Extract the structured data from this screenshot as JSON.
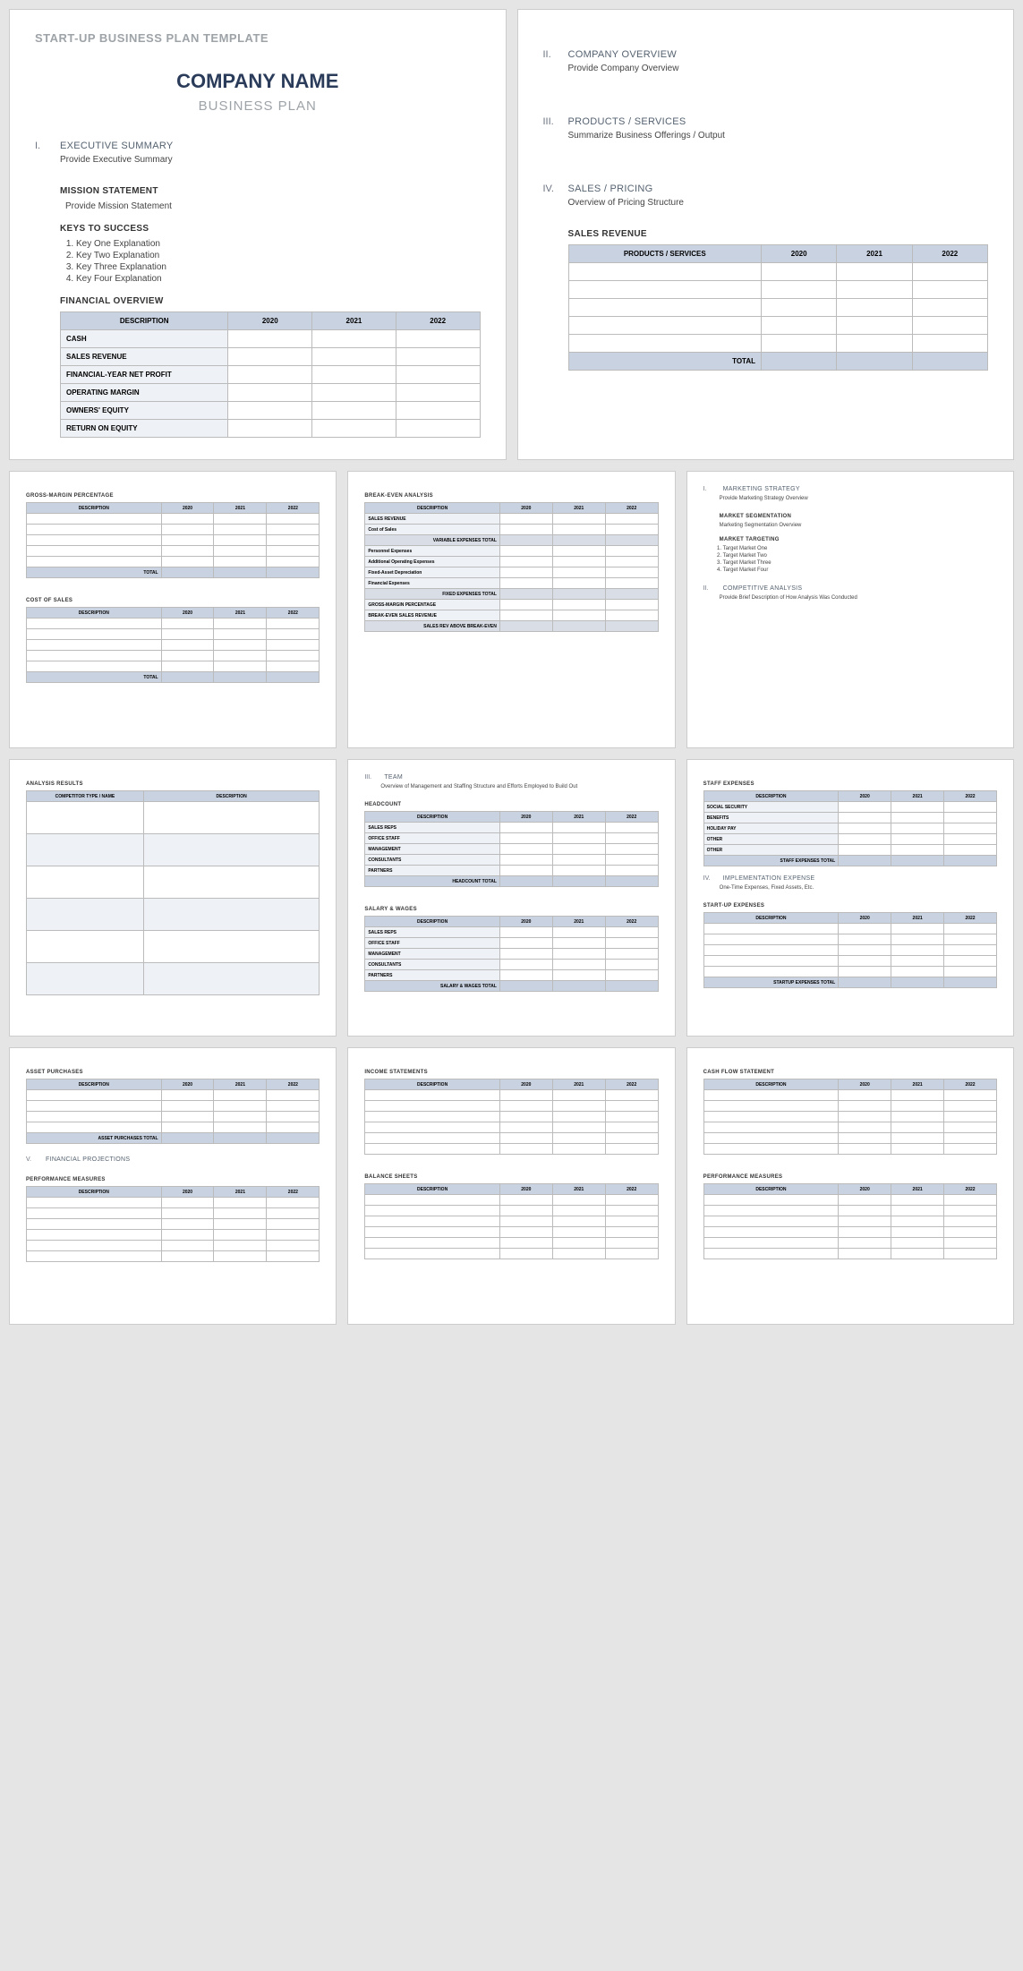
{
  "doc_title": "START-UP BUSINESS PLAN TEMPLATE",
  "company_name": "COMPANY NAME",
  "subtitle": "BUSINESS PLAN",
  "years": [
    "2020",
    "2021",
    "2022"
  ],
  "sec1": {
    "num": "I.",
    "title": "EXECUTIVE SUMMARY",
    "body": "Provide Executive Summary"
  },
  "mission": {
    "head": "MISSION STATEMENT",
    "body": "Provide Mission Statement"
  },
  "keys": {
    "head": "KEYS TO SUCCESS",
    "items": [
      "Key One Explanation",
      "Key Two Explanation",
      "Key Three Explanation",
      "Key Four Explanation"
    ]
  },
  "fin_overview": {
    "head": "FINANCIAL OVERVIEW",
    "desc_col": "DESCRIPTION",
    "rows": [
      "CASH",
      "SALES REVENUE",
      "FINANCIAL-YEAR NET PROFIT",
      "OPERATING MARGIN",
      "OWNERS' EQUITY",
      "RETURN ON EQUITY"
    ]
  },
  "sec2": {
    "num": "II.",
    "title": "COMPANY OVERVIEW",
    "body": "Provide Company Overview"
  },
  "sec3": {
    "num": "III.",
    "title": "PRODUCTS / SERVICES",
    "body": "Summarize Business Offerings / Output"
  },
  "sec4": {
    "num": "IV.",
    "title": "SALES / PRICING",
    "body": "Overview of Pricing Structure"
  },
  "sales_rev": {
    "head": "SALES REVENUE",
    "col1": "PRODUCTS / SERVICES",
    "total": "TOTAL"
  },
  "gmp": {
    "head": "GROSS-MARGIN PERCENTAGE",
    "desc": "DESCRIPTION",
    "total": "TOTAL"
  },
  "cos": {
    "head": "COST OF SALES",
    "desc": "DESCRIPTION",
    "total": "TOTAL"
  },
  "bea": {
    "head": "BREAK-EVEN ANALYSIS",
    "desc": "DESCRIPTION",
    "rows": [
      "SALES REVENUE",
      "Cost of Sales"
    ],
    "sub1": "VARIABLE EXPENSES TOTAL",
    "rows2": [
      "Personnel Expenses",
      "Additional Operating Expenses",
      "Fixed-Asset Depreciation",
      "Financial Expenses"
    ],
    "sub2": "FIXED EXPENSES TOTAL",
    "rows3": [
      "GROSS-MARGIN PERCENTAGE",
      "BREAK-EVEN SALES REVENUE"
    ],
    "sub3": "SALES REV ABOVE BREAK-EVEN"
  },
  "mktg": {
    "num": "I.",
    "title": "MARKETING STRATEGY",
    "body": "Provide Marketing Strategy Overview"
  },
  "seg": {
    "head": "MARKET SEGMENTATION",
    "body": "Marketing Segmentation Overview"
  },
  "tgt": {
    "head": "MARKET TARGETING",
    "items": [
      "Target Market One",
      "Target Market Two",
      "Target Market Three",
      "Target Market Four"
    ]
  },
  "comp": {
    "num": "II.",
    "title": "COMPETITIVE ANALYSIS",
    "body": "Provide Brief Description of How Analysis Was Conducted"
  },
  "ares": {
    "head": "ANALYSIS RESULTS",
    "col1": "COMPETITOR TYPE / NAME",
    "col2": "DESCRIPTION"
  },
  "team": {
    "num": "III.",
    "title": "TEAM",
    "body": "Overview of Management and Staffing Structure and Efforts Employed to Build Out"
  },
  "hc": {
    "head": "HEADCOUNT",
    "desc": "DESCRIPTION",
    "rows": [
      "SALES REPS",
      "OFFICE STAFF",
      "MANAGEMENT",
      "CONSULTANTS",
      "PARTNERS"
    ],
    "total": "HEADCOUNT TOTAL"
  },
  "sw": {
    "head": "SALARY & WAGES",
    "desc": "DESCRIPTION",
    "rows": [
      "SALES REPS",
      "OFFICE STAFF",
      "MANAGEMENT",
      "CONSULTANTS",
      "PARTNERS"
    ],
    "total": "SALARY & WAGES TOTAL"
  },
  "se": {
    "head": "STAFF EXPENSES",
    "desc": "DESCRIPTION",
    "rows": [
      "SOCIAL SECURITY",
      "BENEFITS",
      "HOLIDAY PAY",
      "OTHER",
      "OTHER"
    ],
    "total": "STAFF EXPENSES TOTAL"
  },
  "ie": {
    "num": "IV.",
    "title": "IMPLEMENTATION EXPENSE",
    "body": "One-Time Expenses, Fixed Assets, Etc."
  },
  "sue": {
    "head": "START-UP EXPENSES",
    "desc": "DESCRIPTION",
    "total": "STARTUP EXPENSES TOTAL"
  },
  "ap": {
    "head": "ASSET PURCHASES",
    "desc": "DESCRIPTION",
    "total": "ASSET PURCHASES TOTAL"
  },
  "fp": {
    "num": "V.",
    "title": "FINANCIAL PROJECTIONS"
  },
  "pm": {
    "head": "PERFORMANCE MEASURES",
    "desc": "DESCRIPTION"
  },
  "is": {
    "head": "INCOME STATEMENTS",
    "desc": "DESCRIPTION"
  },
  "bs": {
    "head": "BALANCE SHEETS",
    "desc": "DESCRIPTION"
  },
  "cf": {
    "head": "CASH FLOW STATEMENT",
    "desc": "DESCRIPTION"
  },
  "pm2": {
    "head": "PERFORMANCE MEASURES",
    "desc": "DESCRIPTION"
  }
}
